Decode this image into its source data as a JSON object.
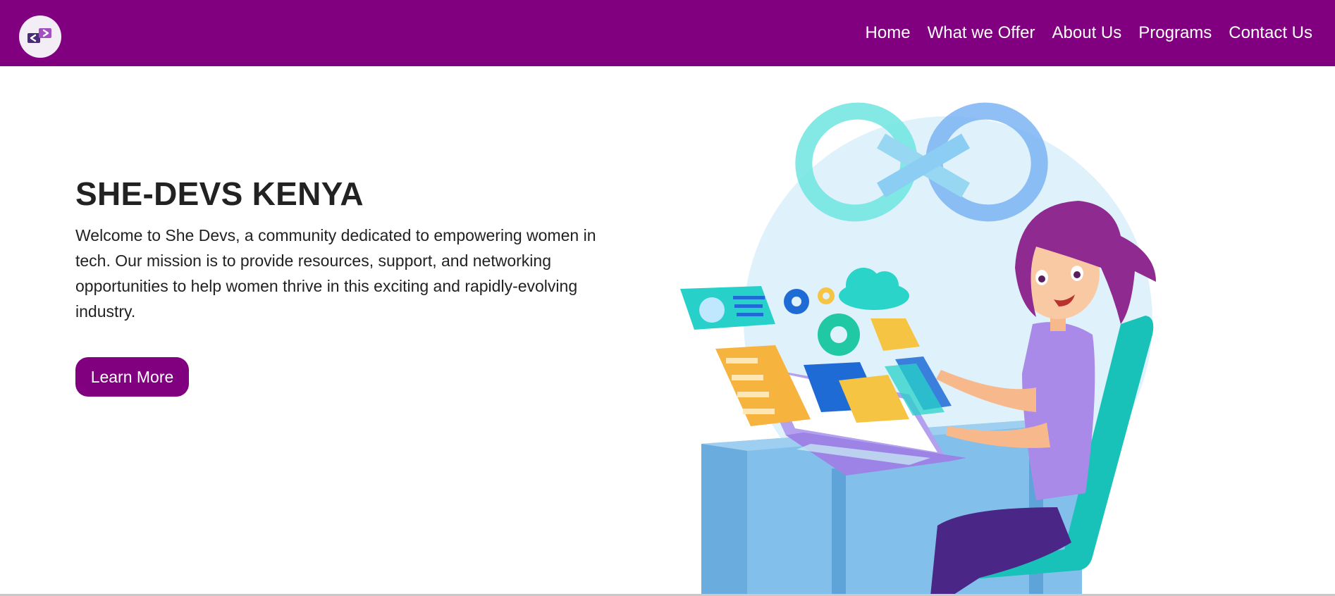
{
  "navbar": {
    "logo_icon": "code-brackets-logo",
    "brand_color": "#800080",
    "links": [
      {
        "label": "Home"
      },
      {
        "label": "What we Offer"
      },
      {
        "label": "About Us"
      },
      {
        "label": "Programs"
      },
      {
        "label": "Contact Us"
      }
    ]
  },
  "hero": {
    "title": "SHE-DEVS KENYA",
    "description": "Welcome to She Devs, a community dedicated to empowering women in tech. Our mission is to provide resources, support, and networking opportunities to help women thrive in this exciting and rapidly-evolving industry.",
    "cta_label": "Learn More"
  },
  "illustration": {
    "subject": "woman-developer-at-laptop-illustration"
  }
}
